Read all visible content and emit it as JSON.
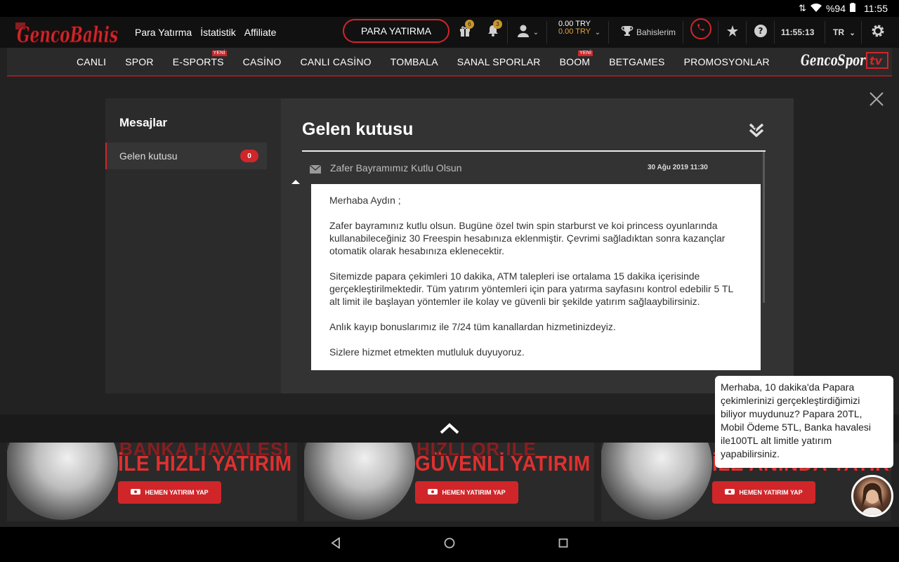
{
  "status_bar": {
    "battery": "%94",
    "time": "11:55"
  },
  "header": {
    "logo_text": "GencoBahis",
    "links": [
      "Para Yatırma",
      "İstatistik",
      "Affiliate"
    ],
    "deposit_button": "PARA YATIRMA",
    "gift_badge": "6",
    "notification_badge": "3",
    "balance_main": "0.00 TRY",
    "balance_bonus": "0.00 TRY",
    "bets_label": "Bahislerim",
    "clock": "11:55:13",
    "language": "TR"
  },
  "main_nav": {
    "items": [
      {
        "label": "CANLI",
        "tag": ""
      },
      {
        "label": "SPOR",
        "tag": ""
      },
      {
        "label": "E-SPORTS",
        "tag": "YENİ"
      },
      {
        "label": "CASİNO",
        "tag": ""
      },
      {
        "label": "CANLI CASİNO",
        "tag": ""
      },
      {
        "label": "TOMBALA",
        "tag": ""
      },
      {
        "label": "SANAL SPORLAR",
        "tag": ""
      },
      {
        "label": "BOOM",
        "tag": "YENİ"
      },
      {
        "label": "BETGAMES",
        "tag": ""
      },
      {
        "label": "PROMOSYONLAR",
        "tag": ""
      }
    ],
    "tv_logo_text": "GencoSpor tv"
  },
  "messages": {
    "sidebar_title": "Mesajlar",
    "inbox_label": "Gelen kutusu",
    "inbox_count": "0",
    "panel_title": "Gelen kutusu",
    "message": {
      "subject": "Zafer Bayramımız Kutlu Olsun",
      "date": "30 Ağu 2019 11:30",
      "body": [
        "Merhaba   Aydın  ;",
        "Zafer bayramınız kutlu olsun. Bugüne özel twin spin starburst ve koi princess oyunlarında kullanabileceğiniz 30 Freespin hesabınıza eklenmiştir. Çevrimi sağladıktan sonra kazançlar otomatik olarak hesabınıza eklenecektir.",
        "Sitemizde papara çekimleri 10 dakika, ATM talepleri ise ortalama 15 dakika içerisinde gerçekleştirilmektedir. Tüm yatırım yöntemleri için para yatırma sayfasını kontrol edebilir 5 TL alt limit ile başlayan yöntemler ile kolay ve güvenli bir şekilde yatırım sağlaaybilirsiniz.",
        "Anlık kayıp bonuslarımız ile 7/24 tüm kanallardan hizmetinizdeyiz.",
        "Sizlere hizmet etmekten mutluluk duyuyoruz."
      ]
    }
  },
  "banners": [
    {
      "line1": "BANKA HAVALESİ",
      "line2": "İLE HIZLI YATIRIM",
      "button": "HEMEN YATIRIM YAP"
    },
    {
      "line1": "HIZLI QR İLE",
      "line2": "GÜVENLİ YATIRIM",
      "button": "HEMEN YATIRIM YAP"
    },
    {
      "line1": "",
      "line2": "İLE ANINDA YATIRIM",
      "button": "HEMEN YATIRIM YAP"
    }
  ],
  "chat": {
    "text": "Merhaba, 10 dakika'da Papara çekimlerinizi gerçekleştirdiğimizi biliyor muydunuz? Papara 20TL, Mobil Ödeme 5TL, Banka havalesi ile100TL alt limitle yatırım yapabilirsiniz."
  },
  "colors": {
    "accent": "#d0262a",
    "gold": "#e6a13b",
    "background": "#222222"
  }
}
